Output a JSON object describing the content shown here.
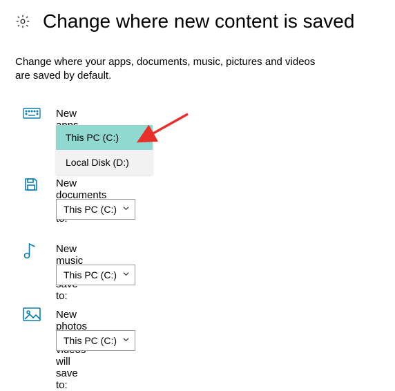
{
  "title": "Change where new content is saved",
  "description": "Change where your apps, documents, music, pictures and videos are saved by default.",
  "sections": {
    "apps": {
      "label": "New apps will save to:",
      "value": "This PC (C:)",
      "options": [
        {
          "label": "This PC (C:)",
          "selected": true
        },
        {
          "label": "Local Disk (D:)",
          "selected": false
        }
      ]
    },
    "docs": {
      "label": "New documents will save to:",
      "value": "This PC (C:)"
    },
    "music": {
      "label": "New music will save to:",
      "value": "This PC (C:)"
    },
    "photos": {
      "label": "New photos and videos will save to:",
      "value": "This PC (C:)"
    }
  }
}
